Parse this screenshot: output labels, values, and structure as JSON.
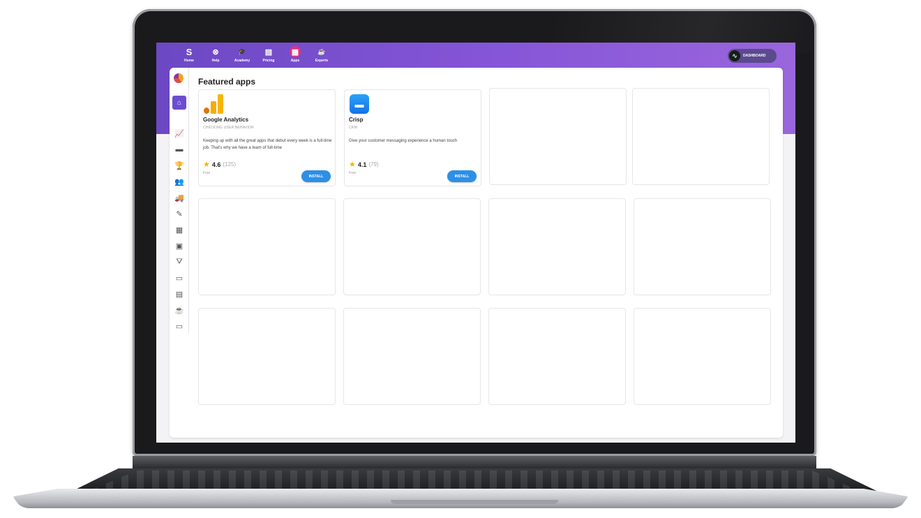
{
  "nav": [
    {
      "name": "nav-home",
      "label": "Home",
      "icon": "S"
    },
    {
      "name": "nav-help",
      "label": "Help",
      "icon": "⊗"
    },
    {
      "name": "nav-academy",
      "label": "Academy",
      "icon": "🎓"
    },
    {
      "name": "nav-pricing",
      "label": "Pricing",
      "icon": "▤"
    },
    {
      "name": "nav-apps",
      "label": "Apps",
      "icon": "▦",
      "active": true
    },
    {
      "name": "nav-experts",
      "label": "Experts",
      "icon": "☕"
    }
  ],
  "dashboard_label": "DASHBOARD",
  "section_title": "Featured apps",
  "apps": [
    {
      "name": "Google Analytics",
      "category": "CHECKING USER BEHAVIOR",
      "description": "Keeping up with all the great apps that debut every week is a full-time job. That's why we have a team of full-time",
      "rating": "4.6",
      "rating_count": "(125)",
      "price": "Free",
      "install_label": "INSTALL"
    },
    {
      "name": "Crisp",
      "category": "CRM",
      "description": "Give your customer messaging experience a human touch",
      "rating": "4.1",
      "rating_count": "(79)",
      "price": "Free",
      "install_label": "INSTALL"
    }
  ],
  "colors": {
    "topbar_start": "#6c48c4",
    "topbar_end": "#9a66dc",
    "active_app_badge": "#e3317d",
    "install_button": "#2d8fe6",
    "star": "#f5b301"
  }
}
